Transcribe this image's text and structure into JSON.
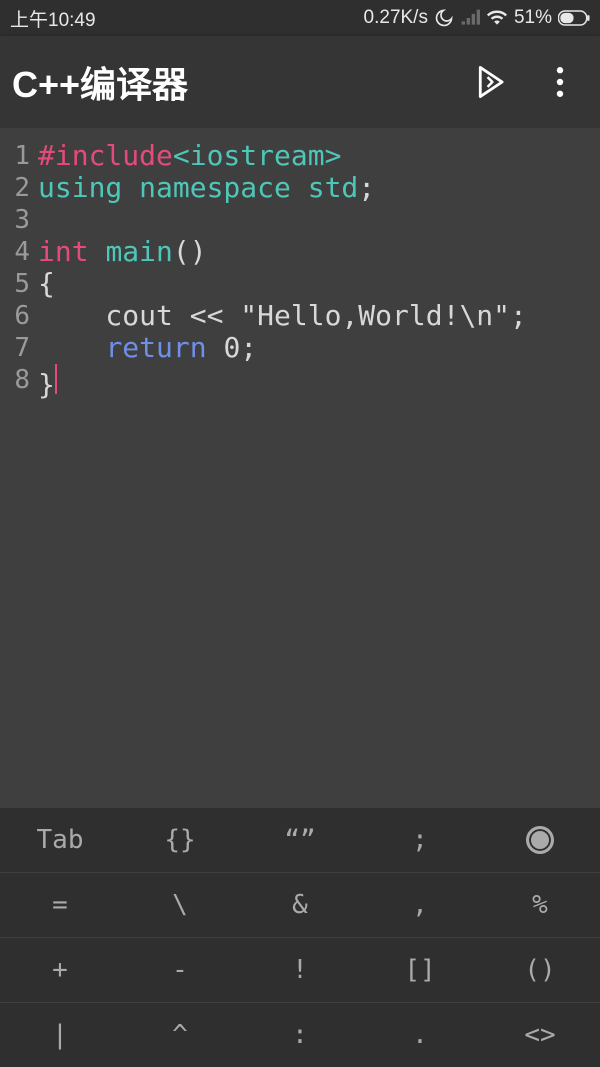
{
  "status": {
    "time": "上午10:49",
    "netspeed": "0.27K/s",
    "battery_pct": "51%"
  },
  "appbar": {
    "title": "C++编译器"
  },
  "code": {
    "lines": [
      {
        "num": "1",
        "tokens": [
          {
            "cls": "tok-keyword",
            "t": "#include"
          },
          {
            "cls": "tok-ident",
            "t": "<iostream>"
          }
        ]
      },
      {
        "num": "2",
        "tokens": [
          {
            "cls": "tok-ident",
            "t": "using namespace std"
          },
          {
            "cls": "tok-plain",
            "t": ";"
          }
        ]
      },
      {
        "num": "3",
        "tokens": []
      },
      {
        "num": "4",
        "tokens": [
          {
            "cls": "tok-keyword",
            "t": "int"
          },
          {
            "cls": "tok-plain",
            "t": " "
          },
          {
            "cls": "tok-ident",
            "t": "main"
          },
          {
            "cls": "tok-plain",
            "t": "()"
          }
        ]
      },
      {
        "num": "5",
        "tokens": [
          {
            "cls": "tok-plain",
            "t": "{"
          }
        ]
      },
      {
        "num": "6",
        "tokens": [
          {
            "cls": "tok-plain",
            "t": "    cout << "
          },
          {
            "cls": "tok-string",
            "t": "\"Hello,World!\\n\""
          },
          {
            "cls": "tok-plain",
            "t": ";"
          }
        ]
      },
      {
        "num": "7",
        "tokens": [
          {
            "cls": "tok-plain",
            "t": "    "
          },
          {
            "cls": "tok-builtin",
            "t": "return"
          },
          {
            "cls": "tok-plain",
            "t": " 0;"
          }
        ]
      },
      {
        "num": "8",
        "tokens": [
          {
            "cls": "tok-plain",
            "t": "}"
          }
        ],
        "cursorAfter": true
      }
    ]
  },
  "keys": {
    "rows": [
      [
        "Tab",
        "{}",
        "“”",
        ";",
        "__CIRCLE__"
      ],
      [
        "=",
        "\\",
        "&",
        ",",
        "%"
      ],
      [
        "+",
        "-",
        "!",
        "[]",
        "()"
      ],
      [
        "|",
        "^",
        ":",
        ".",
        "<>"
      ]
    ]
  }
}
